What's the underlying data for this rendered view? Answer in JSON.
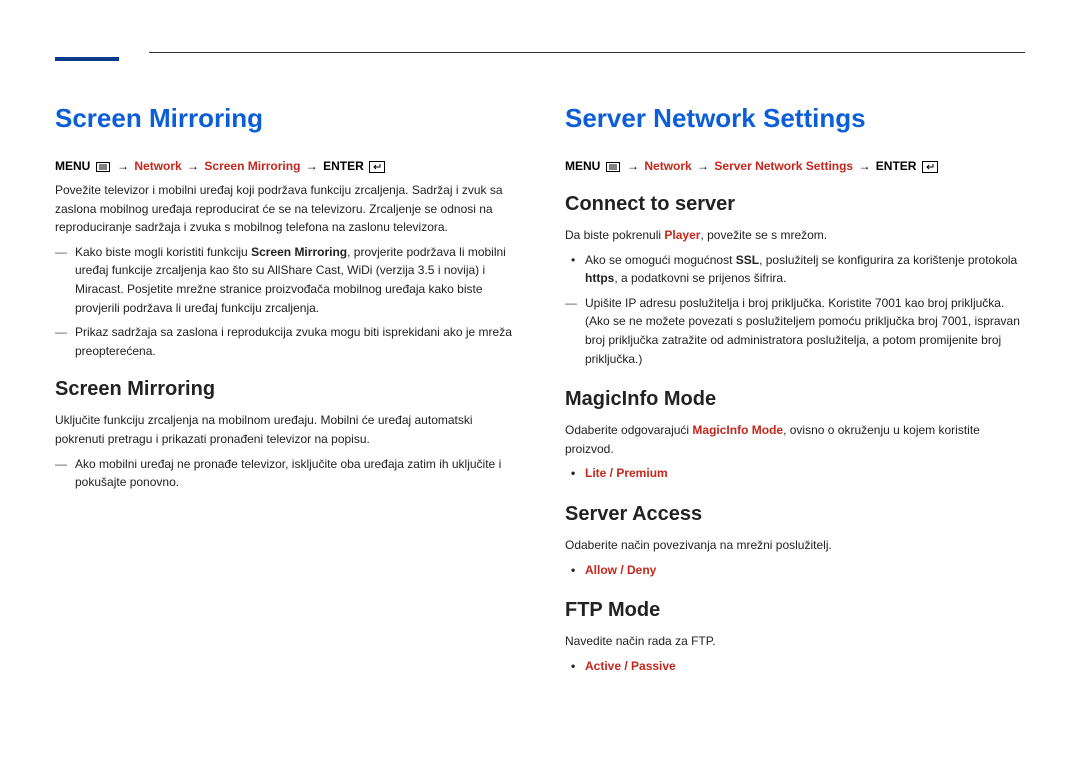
{
  "left": {
    "title": "Screen Mirroring",
    "menu_prefix": "MENU ",
    "menu_network": "Network",
    "menu_section": "Screen Mirroring",
    "menu_enter": "ENTER ",
    "arrow": "→",
    "intro": "Povežite televizor i mobilni uređaj koji podržava funkciju zrcaljenja. Sadržaj i zvuk sa zaslona mobilnog uređaja reproducirat će se na televizoru. Zrcaljenje se odnosi na reproduciranje sadržaja i zvuka s mobilnog telefona na zaslonu televizora.",
    "note1_pre": "Kako biste mogli koristiti funkciju ",
    "note1_bold": "Screen Mirroring",
    "note1_post": ", provjerite podržava li mobilni uređaj funkcije zrcaljenja kao što su AllShare Cast, WiDi (verzija 3.5 i novija) i Miracast. Posjetite mrežne stranice proizvođača mobilnog uređaja kako biste provjerili podržava li uređaj funkciju zrcaljenja.",
    "note2": "Prikaz sadržaja sa zaslona i reprodukcija zvuka mogu biti isprekidani ako je mreža preopterećena.",
    "sub_title": "Screen Mirroring",
    "sub_body": "Uključite funkciju zrcaljenja na mobilnom uređaju. Mobilni će uređaj automatski pokrenuti pretragu i prikazati pronađeni televizor na popisu.",
    "sub_note": "Ako mobilni uređaj ne pronađe televizor, isključite oba uređaja zatim ih uključite i pokušajte ponovno."
  },
  "right": {
    "title": "Server Network Settings",
    "menu_prefix": "MENU ",
    "menu_network": "Network",
    "menu_section": "Server Network Settings",
    "menu_enter": "ENTER ",
    "arrow": "→",
    "connect": {
      "title": "Connect to server",
      "body_pre": "Da biste pokrenuli ",
      "body_bold": "Player",
      "body_post": ", povežite se s mrežom.",
      "bullet_pre": "Ako se omogući mogućnost ",
      "bullet_bold1": "SSL",
      "bullet_mid": ", poslužitelj se konfigurira za korištenje protokola ",
      "bullet_bold2": "https",
      "bullet_post": ", a podatkovni se prijenos šifrira.",
      "dash_note": "Upišite IP adresu poslužitelja i broj priključka. Koristite 7001 kao broj priključka. (Ako se ne možete povezati s poslužiteljem pomoću priključka broj 7001, ispravan broj priključka zatražite od administratora poslužitelja, a potom promijenite broj priključka.)"
    },
    "magicinfo": {
      "title": "MagicInfo Mode",
      "body_pre": "Odaberite odgovarajući ",
      "body_bold": "MagicInfo Mode",
      "body_post": ", ovisno o okruženju u kojem koristite proizvod.",
      "option": "Lite / Premium"
    },
    "server_access": {
      "title": "Server Access",
      "body": "Odaberite način povezivanja na mrežni poslužitelj.",
      "option": "Allow / Deny"
    },
    "ftp": {
      "title": "FTP Mode",
      "body": "Navedite način rada za FTP.",
      "option": "Active / Passive"
    }
  }
}
